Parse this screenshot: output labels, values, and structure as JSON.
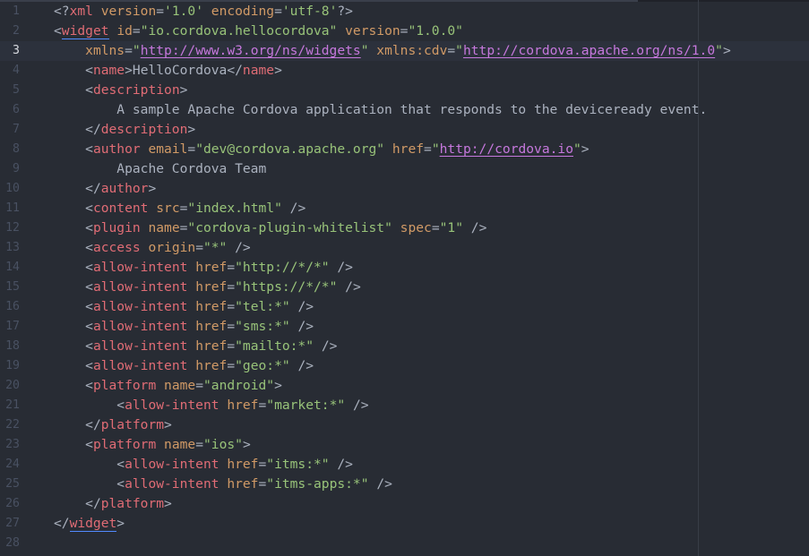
{
  "editor": {
    "cursor_line": 3,
    "lines": [
      {
        "n": "1",
        "indent": "",
        "tokens": [
          [
            "punc",
            "<?"
          ],
          [
            "tag",
            "xml"
          ],
          [
            "text",
            " "
          ],
          [
            "attr",
            "version"
          ],
          [
            "punc",
            "="
          ],
          [
            "str",
            "'1.0'"
          ],
          [
            "text",
            " "
          ],
          [
            "attr",
            "encoding"
          ],
          [
            "punc",
            "="
          ],
          [
            "str",
            "'utf-8'"
          ],
          [
            "punc",
            "?>"
          ]
        ]
      },
      {
        "n": "2",
        "indent": "",
        "tokens": [
          [
            "punc",
            "<"
          ],
          [
            "tagm",
            "widget"
          ],
          [
            "text",
            " "
          ],
          [
            "attr",
            "id"
          ],
          [
            "punc",
            "="
          ],
          [
            "str",
            "\"io.cordova.hellocordova\""
          ],
          [
            "text",
            " "
          ],
          [
            "attr",
            "version"
          ],
          [
            "punc",
            "="
          ],
          [
            "str",
            "\"1.0.0\""
          ]
        ]
      },
      {
        "n": "3",
        "indent": "    ",
        "tokens": [
          [
            "attr",
            "xmlns"
          ],
          [
            "punc",
            "="
          ],
          [
            "quote",
            "\""
          ],
          [
            "url",
            "http://www.w3.org/ns/widgets"
          ],
          [
            "quote",
            "\""
          ],
          [
            "text",
            " "
          ],
          [
            "attr",
            "xmlns:cdv"
          ],
          [
            "punc",
            "="
          ],
          [
            "quote",
            "\""
          ],
          [
            "url",
            "http://cordova.apache.org/ns/1.0"
          ],
          [
            "quote",
            "\""
          ],
          [
            "punc",
            ">"
          ]
        ]
      },
      {
        "n": "4",
        "indent": "    ",
        "tokens": [
          [
            "punc",
            "<"
          ],
          [
            "tag",
            "name"
          ],
          [
            "punc",
            ">"
          ],
          [
            "text",
            "HelloCordova"
          ],
          [
            "punc",
            "</"
          ],
          [
            "tag",
            "name"
          ],
          [
            "punc",
            ">"
          ]
        ]
      },
      {
        "n": "5",
        "indent": "    ",
        "tokens": [
          [
            "punc",
            "<"
          ],
          [
            "tag",
            "description"
          ],
          [
            "punc",
            ">"
          ]
        ]
      },
      {
        "n": "6",
        "indent": "        ",
        "tokens": [
          [
            "text",
            "A sample Apache Cordova application that responds to the deviceready event."
          ]
        ]
      },
      {
        "n": "7",
        "indent": "    ",
        "tokens": [
          [
            "punc",
            "</"
          ],
          [
            "tag",
            "description"
          ],
          [
            "punc",
            ">"
          ]
        ]
      },
      {
        "n": "8",
        "indent": "    ",
        "tokens": [
          [
            "punc",
            "<"
          ],
          [
            "tag",
            "author"
          ],
          [
            "text",
            " "
          ],
          [
            "attr",
            "email"
          ],
          [
            "punc",
            "="
          ],
          [
            "str",
            "\"dev@cordova.apache.org\""
          ],
          [
            "text",
            " "
          ],
          [
            "attr",
            "href"
          ],
          [
            "punc",
            "="
          ],
          [
            "quote",
            "\""
          ],
          [
            "url",
            "http://cordova.io"
          ],
          [
            "quote",
            "\""
          ],
          [
            "punc",
            ">"
          ]
        ]
      },
      {
        "n": "9",
        "indent": "        ",
        "tokens": [
          [
            "text",
            "Apache Cordova Team"
          ]
        ]
      },
      {
        "n": "10",
        "indent": "    ",
        "tokens": [
          [
            "punc",
            "</"
          ],
          [
            "tag",
            "author"
          ],
          [
            "punc",
            ">"
          ]
        ]
      },
      {
        "n": "11",
        "indent": "    ",
        "tokens": [
          [
            "punc",
            "<"
          ],
          [
            "tag",
            "content"
          ],
          [
            "text",
            " "
          ],
          [
            "attr",
            "src"
          ],
          [
            "punc",
            "="
          ],
          [
            "str",
            "\"index.html\""
          ],
          [
            "text",
            " "
          ],
          [
            "punc",
            "/>"
          ]
        ]
      },
      {
        "n": "12",
        "indent": "    ",
        "tokens": [
          [
            "punc",
            "<"
          ],
          [
            "tag",
            "plugin"
          ],
          [
            "text",
            " "
          ],
          [
            "attr",
            "name"
          ],
          [
            "punc",
            "="
          ],
          [
            "str",
            "\"cordova-plugin-whitelist\""
          ],
          [
            "text",
            " "
          ],
          [
            "attr",
            "spec"
          ],
          [
            "punc",
            "="
          ],
          [
            "str",
            "\"1\""
          ],
          [
            "text",
            " "
          ],
          [
            "punc",
            "/>"
          ]
        ]
      },
      {
        "n": "13",
        "indent": "    ",
        "tokens": [
          [
            "punc",
            "<"
          ],
          [
            "tag",
            "access"
          ],
          [
            "text",
            " "
          ],
          [
            "attr",
            "origin"
          ],
          [
            "punc",
            "="
          ],
          [
            "str",
            "\"*\""
          ],
          [
            "text",
            " "
          ],
          [
            "punc",
            "/>"
          ]
        ]
      },
      {
        "n": "14",
        "indent": "    ",
        "tokens": [
          [
            "punc",
            "<"
          ],
          [
            "tag",
            "allow-intent"
          ],
          [
            "text",
            " "
          ],
          [
            "attr",
            "href"
          ],
          [
            "punc",
            "="
          ],
          [
            "str",
            "\"http://*/*\""
          ],
          [
            "text",
            " "
          ],
          [
            "punc",
            "/>"
          ]
        ]
      },
      {
        "n": "15",
        "indent": "    ",
        "tokens": [
          [
            "punc",
            "<"
          ],
          [
            "tag",
            "allow-intent"
          ],
          [
            "text",
            " "
          ],
          [
            "attr",
            "href"
          ],
          [
            "punc",
            "="
          ],
          [
            "str",
            "\"https://*/*\""
          ],
          [
            "text",
            " "
          ],
          [
            "punc",
            "/>"
          ]
        ]
      },
      {
        "n": "16",
        "indent": "    ",
        "tokens": [
          [
            "punc",
            "<"
          ],
          [
            "tag",
            "allow-intent"
          ],
          [
            "text",
            " "
          ],
          [
            "attr",
            "href"
          ],
          [
            "punc",
            "="
          ],
          [
            "str",
            "\"tel:*\""
          ],
          [
            "text",
            " "
          ],
          [
            "punc",
            "/>"
          ]
        ]
      },
      {
        "n": "17",
        "indent": "    ",
        "tokens": [
          [
            "punc",
            "<"
          ],
          [
            "tag",
            "allow-intent"
          ],
          [
            "text",
            " "
          ],
          [
            "attr",
            "href"
          ],
          [
            "punc",
            "="
          ],
          [
            "str",
            "\"sms:*\""
          ],
          [
            "text",
            " "
          ],
          [
            "punc",
            "/>"
          ]
        ]
      },
      {
        "n": "18",
        "indent": "    ",
        "tokens": [
          [
            "punc",
            "<"
          ],
          [
            "tag",
            "allow-intent"
          ],
          [
            "text",
            " "
          ],
          [
            "attr",
            "href"
          ],
          [
            "punc",
            "="
          ],
          [
            "str",
            "\"mailto:*\""
          ],
          [
            "text",
            " "
          ],
          [
            "punc",
            "/>"
          ]
        ]
      },
      {
        "n": "19",
        "indent": "    ",
        "tokens": [
          [
            "punc",
            "<"
          ],
          [
            "tag",
            "allow-intent"
          ],
          [
            "text",
            " "
          ],
          [
            "attr",
            "href"
          ],
          [
            "punc",
            "="
          ],
          [
            "str",
            "\"geo:*\""
          ],
          [
            "text",
            " "
          ],
          [
            "punc",
            "/>"
          ]
        ]
      },
      {
        "n": "20",
        "indent": "    ",
        "tokens": [
          [
            "punc",
            "<"
          ],
          [
            "tag",
            "platform"
          ],
          [
            "text",
            " "
          ],
          [
            "attr",
            "name"
          ],
          [
            "punc",
            "="
          ],
          [
            "str",
            "\"android\""
          ],
          [
            "punc",
            ">"
          ]
        ]
      },
      {
        "n": "21",
        "indent": "        ",
        "tokens": [
          [
            "punc",
            "<"
          ],
          [
            "tag",
            "allow-intent"
          ],
          [
            "text",
            " "
          ],
          [
            "attr",
            "href"
          ],
          [
            "punc",
            "="
          ],
          [
            "str",
            "\"market:*\""
          ],
          [
            "text",
            " "
          ],
          [
            "punc",
            "/>"
          ]
        ]
      },
      {
        "n": "22",
        "indent": "    ",
        "tokens": [
          [
            "punc",
            "</"
          ],
          [
            "tag",
            "platform"
          ],
          [
            "punc",
            ">"
          ]
        ]
      },
      {
        "n": "23",
        "indent": "    ",
        "tokens": [
          [
            "punc",
            "<"
          ],
          [
            "tag",
            "platform"
          ],
          [
            "text",
            " "
          ],
          [
            "attr",
            "name"
          ],
          [
            "punc",
            "="
          ],
          [
            "str",
            "\"ios\""
          ],
          [
            "punc",
            ">"
          ]
        ]
      },
      {
        "n": "24",
        "indent": "        ",
        "tokens": [
          [
            "punc",
            "<"
          ],
          [
            "tag",
            "allow-intent"
          ],
          [
            "text",
            " "
          ],
          [
            "attr",
            "href"
          ],
          [
            "punc",
            "="
          ],
          [
            "str",
            "\"itms:*\""
          ],
          [
            "text",
            " "
          ],
          [
            "punc",
            "/>"
          ]
        ]
      },
      {
        "n": "25",
        "indent": "        ",
        "tokens": [
          [
            "punc",
            "<"
          ],
          [
            "tag",
            "allow-intent"
          ],
          [
            "text",
            " "
          ],
          [
            "attr",
            "href"
          ],
          [
            "punc",
            "="
          ],
          [
            "str",
            "\"itms-apps:*\""
          ],
          [
            "text",
            " "
          ],
          [
            "punc",
            "/>"
          ]
        ]
      },
      {
        "n": "26",
        "indent": "    ",
        "tokens": [
          [
            "punc",
            "</"
          ],
          [
            "tag",
            "platform"
          ],
          [
            "punc",
            ">"
          ]
        ]
      },
      {
        "n": "27",
        "indent": "",
        "tokens": [
          [
            "punc",
            "</"
          ],
          [
            "tagm",
            "widget"
          ],
          [
            "punc",
            ">"
          ]
        ]
      },
      {
        "n": "28",
        "indent": "",
        "tokens": []
      }
    ]
  },
  "theme": {
    "background": "#282c34",
    "tag": "#e06c75",
    "attribute": "#d19a66",
    "string": "#98c379",
    "url": "#c678dd",
    "text": "#abb2bf",
    "gutter": "#495162"
  }
}
